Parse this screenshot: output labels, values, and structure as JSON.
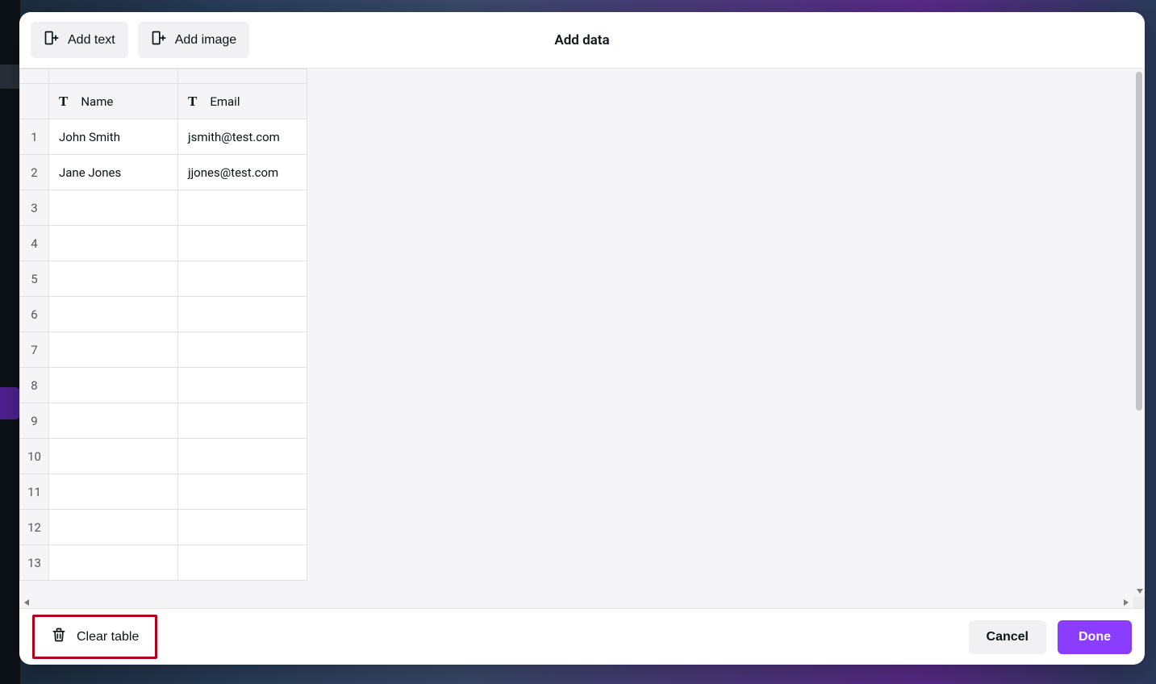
{
  "header": {
    "title": "Add data",
    "add_text_label": "Add text",
    "add_image_label": "Add image"
  },
  "table": {
    "columns": [
      {
        "type_icon": "T",
        "label": "Name"
      },
      {
        "type_icon": "T",
        "label": "Email"
      }
    ],
    "rows": [
      {
        "n": "1",
        "a": "John Smith",
        "b": "jsmith@test.com"
      },
      {
        "n": "2",
        "a": "Jane Jones",
        "b": "jjones@test.com"
      },
      {
        "n": "3",
        "a": "",
        "b": ""
      },
      {
        "n": "4",
        "a": "",
        "b": ""
      },
      {
        "n": "5",
        "a": "",
        "b": ""
      },
      {
        "n": "6",
        "a": "",
        "b": ""
      },
      {
        "n": "7",
        "a": "",
        "b": ""
      },
      {
        "n": "8",
        "a": "",
        "b": ""
      },
      {
        "n": "9",
        "a": "",
        "b": ""
      },
      {
        "n": "10",
        "a": "",
        "b": ""
      },
      {
        "n": "11",
        "a": "",
        "b": ""
      },
      {
        "n": "12",
        "a": "",
        "b": ""
      },
      {
        "n": "13",
        "a": "",
        "b": ""
      }
    ]
  },
  "footer": {
    "clear_label": "Clear table",
    "cancel_label": "Cancel",
    "done_label": "Done"
  }
}
